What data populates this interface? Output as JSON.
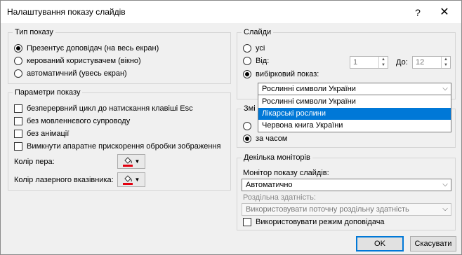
{
  "window": {
    "title": "Налаштування показу слайдів",
    "help": "?",
    "close": "✕"
  },
  "show_type": {
    "title": "Тип показу",
    "options": [
      {
        "label": "Презентує доповідач (на весь екран)",
        "checked": true
      },
      {
        "label": "керований користувачем (вікно)",
        "checked": false
      },
      {
        "label": "автоматичний (увесь екран)",
        "checked": false
      }
    ]
  },
  "show_options": {
    "title": "Параметри показу",
    "checkboxes": [
      "безперервний цикл до натискання клавіші Esc",
      "без мовленнєвого супроводу",
      "без анімації",
      "Вимкнути апаратне прискорення обробки зображення"
    ],
    "pen_color_label": "Колір пера:",
    "laser_color_label": "Колір лазерного вказівника:",
    "pen_color": "#e3000f",
    "laser_color": "#e3000f"
  },
  "slides": {
    "title": "Слайди",
    "all_label": "усі",
    "from_label": "Від:",
    "from_value": "1",
    "to_label": "До:",
    "to_value": "12",
    "custom_label": "вибірковий показ:",
    "custom_value": "Рослинні символи України",
    "dropdown_options": [
      "Рослинні символи України",
      "Лікарські рослини",
      "Червона книга України"
    ],
    "dropdown_selected_index": 1
  },
  "advance": {
    "title_visible": "Змі",
    "manual_label": "",
    "timing_label": "за часом"
  },
  "monitors": {
    "title": "Декілька моніторів",
    "monitor_label": "Монітор показу слайдів:",
    "monitor_value": "Автоматично",
    "resolution_label": "Роздільна здатність:",
    "resolution_value": "Використовувати поточну роздільну здатність",
    "presenter_view_label": "Використовувати режим доповідача"
  },
  "buttons": {
    "ok": "OK",
    "cancel": "Скасувати"
  },
  "icons": {
    "color_picker": "paint-bucket-icon",
    "dropdown": "chevron-down-icon"
  }
}
